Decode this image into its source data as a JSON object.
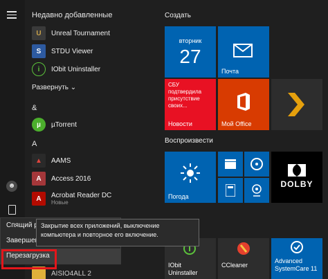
{
  "recent_header": "Недавно добавленные",
  "recent": [
    {
      "label": "Unreal Tournament",
      "icon": "unreal-tournament-icon"
    },
    {
      "label": "STDU Viewer",
      "icon": "stdu-viewer-icon"
    },
    {
      "label": "IObit Uninstaller",
      "icon": "iobit-uninstaller-icon"
    }
  ],
  "expand_label": "Развернуть ⌄",
  "amp_letter": "&",
  "a_letter": "A",
  "utorrent": "µTorrent",
  "a_apps": [
    {
      "label": "AAMS",
      "icon": "aams-icon"
    },
    {
      "label": "Access 2016",
      "icon": "access-icon"
    },
    {
      "label": "Acrobat Reader DC",
      "icon": "acrobat-icon"
    },
    {
      "sub": "Новые"
    }
  ],
  "aisio": "AISIO4ALL 2",
  "create_header": "Создать",
  "play_header": "Воспроизвести",
  "calendar": {
    "day": "вторник",
    "date": "27"
  },
  "mail": "Почта",
  "news": {
    "text": "СБУ подтвердила присутствие своих...",
    "label": "Новости"
  },
  "office": "Мой Office",
  "weather": "Погода",
  "dolby": "DOLBY",
  "iobit_tile": "IObit Uninstaller",
  "ccleaner": "CCleaner",
  "advanced": "Advanced SystemCare 11",
  "power_menu": [
    "Спящий режим",
    "Завершение работы",
    "Перезагрузка"
  ],
  "tooltip": "Закрытие всех приложений, выключение компьютера и повторное его включение.",
  "colors": {
    "accent_blue": "#0063b1",
    "news_red": "#e81123",
    "office_orange": "#d83b01",
    "highlight": "#e4161b"
  }
}
